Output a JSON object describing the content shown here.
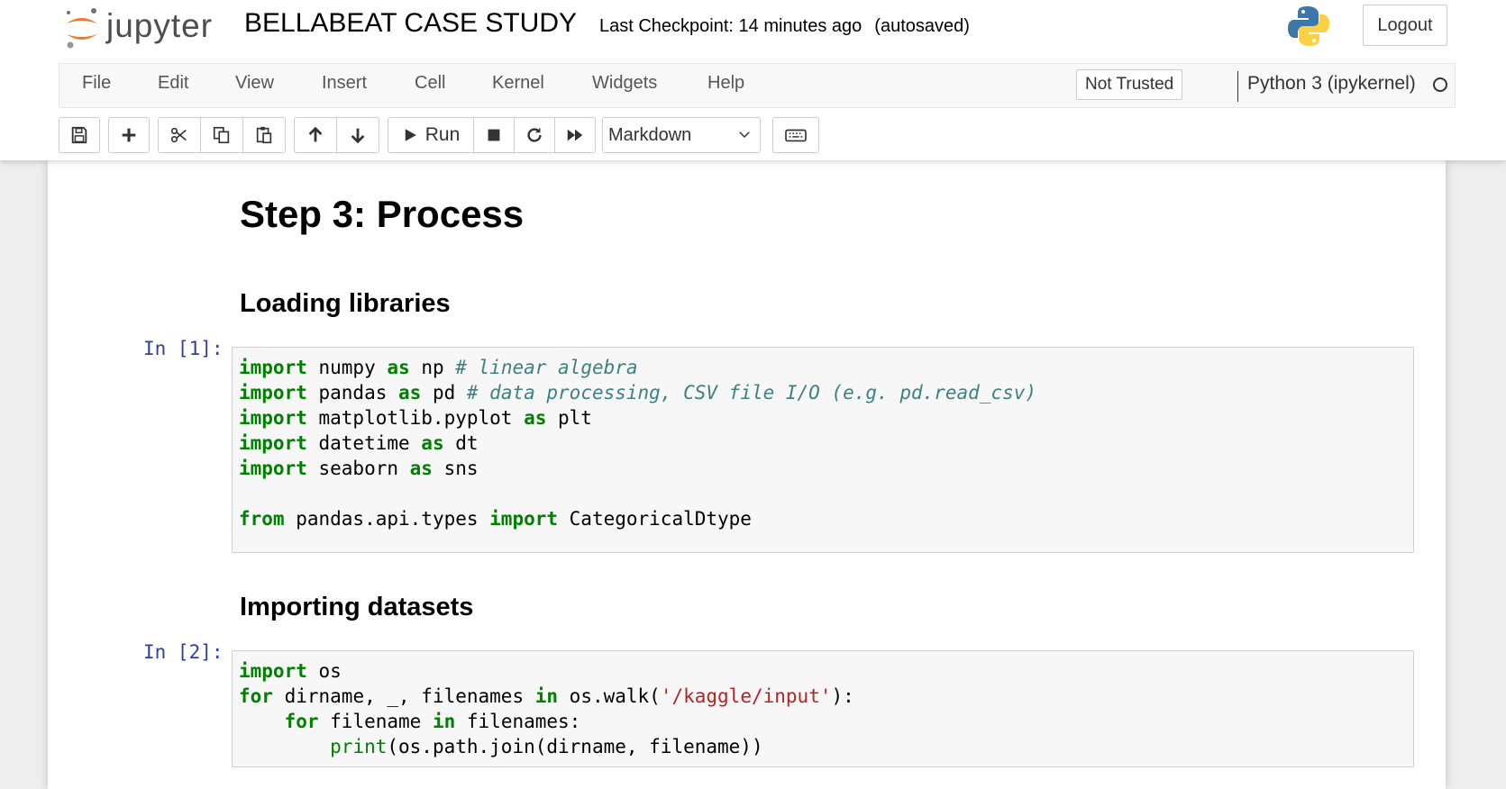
{
  "header": {
    "logo_text": "jupyter",
    "notebook_name": "BELLABEAT CASE STUDY",
    "checkpoint": "Last Checkpoint: 14 minutes ago",
    "autosave": "(autosaved)",
    "logout_label": "Logout"
  },
  "menubar": {
    "items": [
      "File",
      "Edit",
      "View",
      "Insert",
      "Cell",
      "Kernel",
      "Widgets",
      "Help"
    ],
    "trust_label": "Not Trusted",
    "kernel_name": "Python 3 (ipykernel)"
  },
  "toolbar": {
    "run_label": "Run",
    "cell_type": "Markdown",
    "icons": [
      "save-icon",
      "plus-icon",
      "cut-icon",
      "copy-icon",
      "paste-icon",
      "arrow-up-icon",
      "arrow-down-icon",
      "play-icon",
      "stop-icon",
      "restart-icon",
      "fast-forward-icon",
      "keyboard-icon"
    ]
  },
  "cells": {
    "h1": "Step 3: Process",
    "h3_libraries": "Loading libraries",
    "h3_datasets": "Importing datasets",
    "prompt1": "In [1]:",
    "prompt2": "In [2]:"
  },
  "colors": {
    "keyword": "#008000",
    "comment": "#408080",
    "string": "#ba2121",
    "prompt": "#303f9f"
  }
}
